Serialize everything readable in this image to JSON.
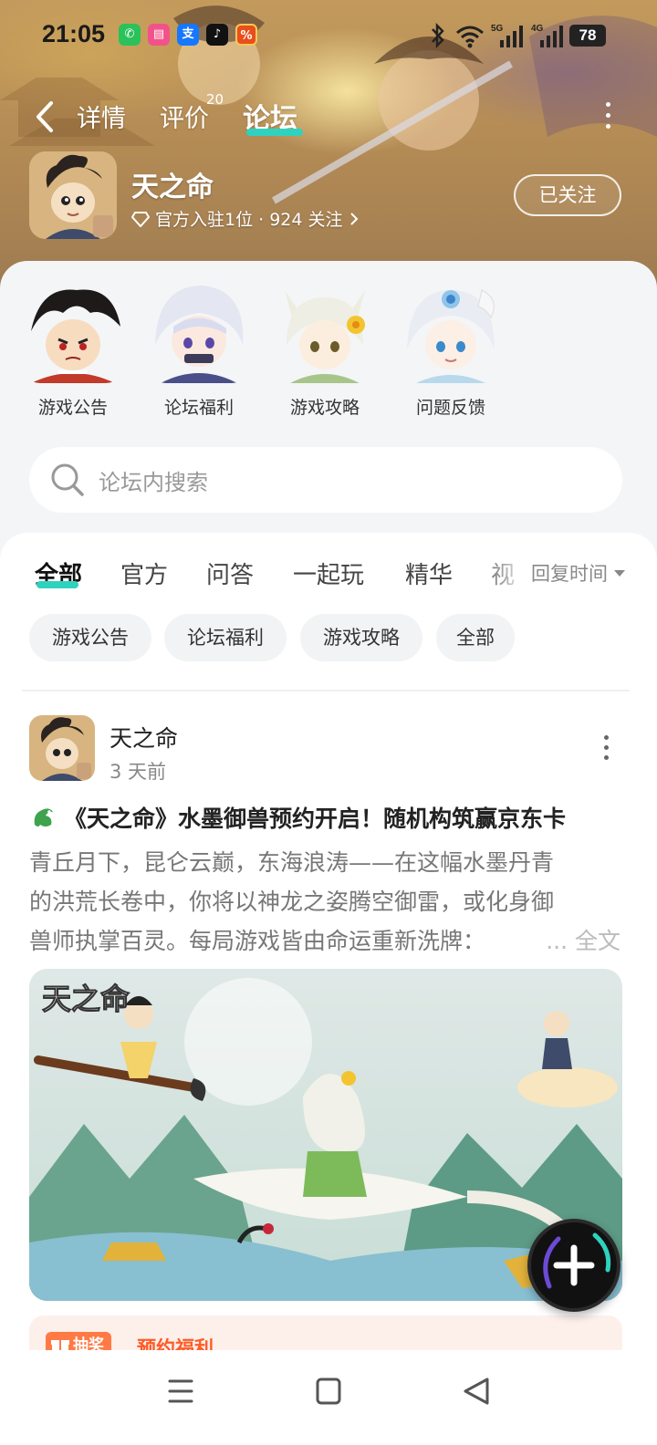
{
  "status_bar": {
    "time": "21:05",
    "battery": "78",
    "network_1": "5G",
    "network_2": "4G"
  },
  "nav": {
    "tabs": [
      {
        "label": "详情"
      },
      {
        "label": "评价"
      },
      {
        "label": "论坛"
      }
    ],
    "review_count": "20",
    "active_tab": "论坛"
  },
  "game": {
    "name": "天之命",
    "meta": "官方入驻1位 · 924 关注",
    "follow_label": "已关注"
  },
  "sections": [
    {
      "label": "游戏公告"
    },
    {
      "label": "论坛福利"
    },
    {
      "label": "游戏攻略"
    },
    {
      "label": "问题反馈"
    }
  ],
  "search": {
    "placeholder": "论坛内搜索"
  },
  "filter_tabs": [
    {
      "label": "全部"
    },
    {
      "label": "官方"
    },
    {
      "label": "问答"
    },
    {
      "label": "一起玩"
    },
    {
      "label": "精华"
    },
    {
      "label": "视"
    }
  ],
  "sort_label": "回复时间",
  "chips": [
    {
      "label": "游戏公告"
    },
    {
      "label": "论坛福利"
    },
    {
      "label": "游戏攻略"
    },
    {
      "label": "全部"
    }
  ],
  "post": {
    "author": "天之命",
    "time": "3 天前",
    "title": "《天之命》水墨御兽预约开启！随机构筑赢京东卡",
    "body_lines": [
      "青丘月下，昆仑云巅，东海浪涛——在这幅水墨丹青",
      "的洪荒长卷中，你将以神龙之姿腾空御雷，或化身御",
      "兽师执掌百灵。每局游戏皆由命运重新洗牌："
    ],
    "read_more": "... 全文",
    "image_logo": "天之命"
  },
  "promo": {
    "tag": "抽奖",
    "text": "预约福利"
  },
  "colors": {
    "accent": "#2fd2bf",
    "promo": "#ff5a26"
  }
}
